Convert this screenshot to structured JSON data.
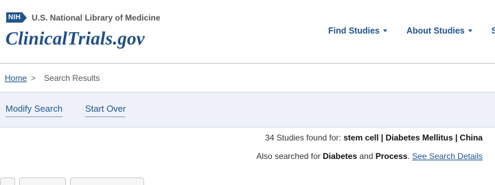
{
  "header": {
    "nih_logo_text": "NIH",
    "nlm_text": "U.S. National Library of Medicine",
    "brand": "ClinicalTrials.gov",
    "nav": [
      {
        "label": "Find Studies"
      },
      {
        "label": "About Studies"
      },
      {
        "label": "S"
      }
    ]
  },
  "breadcrumb": {
    "home": "Home",
    "separator": ">",
    "current": "Search Results"
  },
  "toolbar": {
    "modify": "Modify Search",
    "start_over": "Start Over"
  },
  "results": {
    "count_text": "34 Studies found for:",
    "query": "stem cell | Diabetes Mellitus | China",
    "also_text": "Also searched for",
    "term1": "Diabetes",
    "and_text": "and",
    "term2": "Process",
    "period": ".",
    "details_link": "See Search Details"
  },
  "colors": {
    "brand_blue": "#1f4f86",
    "link_blue": "#20558a",
    "toolbar_bg": "#eef2f8"
  }
}
